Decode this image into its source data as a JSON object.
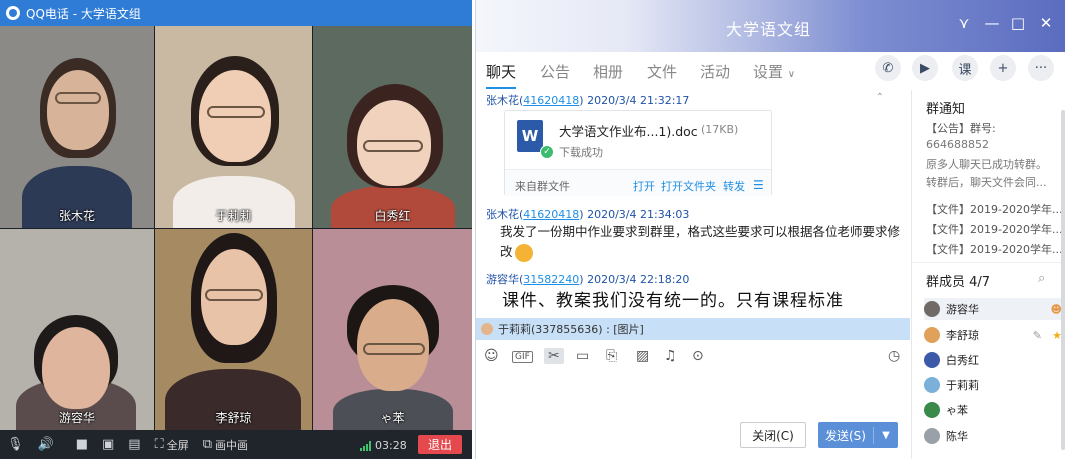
{
  "call": {
    "title": "QQ电话 - 大学语文组",
    "participants": [
      {
        "name": "张木花",
        "bg": "#8c8a86",
        "skin": "#d7b39a",
        "hair": "#3a2b24",
        "shirt": "#2d3a55"
      },
      {
        "name": "于莉莉",
        "bg": "#c9b9a2",
        "skin": "#f0cdb5",
        "hair": "#2a1f1a",
        "shirt": "#f2ede8"
      },
      {
        "name": "白秀红",
        "bg": "#5d6a60",
        "skin": "#f1d2bd",
        "hair": "#3b2420",
        "shirt": "#b24a3b"
      },
      {
        "name": "游容华",
        "bg": "#b5b2ac",
        "skin": "#dfb59d",
        "hair": "#1e1a19",
        "shirt": "#5a4c4c"
      },
      {
        "name": "李舒琼",
        "bg": "#a58a62",
        "skin": "#e8c3a8",
        "hair": "#1f1817",
        "shirt": "#3a2a2a"
      },
      {
        "name": "ゃ苯",
        "bg": "#b98e97",
        "skin": "#d9ad8c",
        "hair": "#1c1615",
        "shirt": "#4d4f56"
      }
    ],
    "toolbar": {
      "fullscreen": "全屏",
      "pip": "画中画",
      "time": "03:28",
      "hangup": "退出"
    }
  },
  "chat": {
    "title": "大学语文组",
    "tabs": [
      "聊天",
      "公告",
      "相册",
      "文件",
      "活动",
      "设置"
    ],
    "messages": [
      {
        "sender": "张木花",
        "uid": "41620418",
        "time": "2020/3/4 21:32:17"
      },
      {
        "sender": "张木花",
        "uid": "41620418",
        "time": "2020/3/4 21:34:03",
        "text1": "我发了一份期中作业要求到群里，格式这些要求可以根据各位老师要求修",
        "text2": "改"
      },
      {
        "sender": "游容华",
        "uid": "31582240",
        "time": "2020/3/4 22:18:20",
        "text1": "课件、教案我们没有统一的。只有课程标准"
      }
    ],
    "file": {
      "name": "大学语文作业布...1).doc",
      "size": "(17KB)",
      "status": "下载成功",
      "source": "来自群文件",
      "open": "打开",
      "open_folder": "打开文件夹",
      "forward": "转发"
    },
    "notice_bar": "于莉莉(337855636) : [图片]",
    "close_label": "关闭(C)",
    "send_label": "发送(S)",
    "sidebar": {
      "notice_title": "群通知",
      "notice_lines": [
        "【公告】群号:",
        "664688852",
        "原多人聊天已成功转群。",
        "转群后，聊天文件会同..."
      ],
      "docs": [
        "【文件】2019-2020学年...",
        "【文件】2019-2020学年...",
        "【文件】2019-2020学年..."
      ],
      "members_title": "群成员 4/7",
      "members": [
        {
          "name": "游容华",
          "color": "#6f6a66"
        },
        {
          "name": "李舒琼",
          "color": "#e0a15a"
        },
        {
          "name": "白秀红",
          "color": "#3c5aa8"
        },
        {
          "name": "于莉莉",
          "color": "#7bb0d8"
        },
        {
          "name": "ゃ苯",
          "color": "#3a8a4a"
        },
        {
          "name": "陈华",
          "color": "#9aa0a8"
        }
      ]
    }
  }
}
